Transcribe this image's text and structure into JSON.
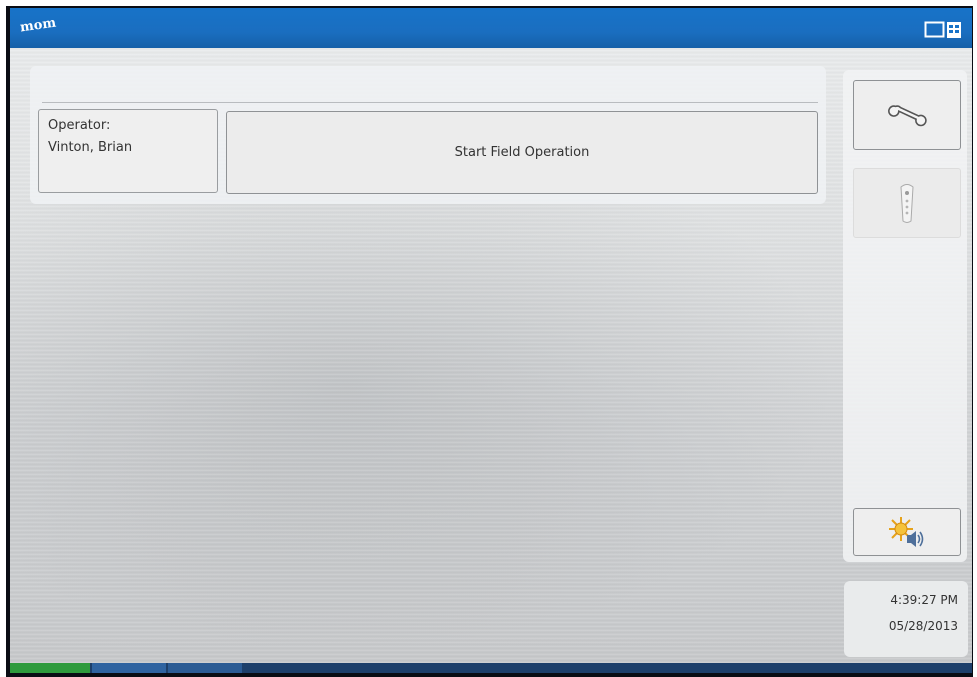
{
  "header": {
    "logo_text": "mom",
    "icons": {
      "display_switch": "display-switch-icon"
    },
    "colors": {
      "bar": "#1773c8"
    }
  },
  "main": {
    "operator_label": "Operator:",
    "operator_name": "Vinton, Brian",
    "start_button_label": "Start Field Operation"
  },
  "sidebar": {
    "items": [
      {
        "name": "wrench-icon",
        "enabled": true
      },
      {
        "name": "remote-icon",
        "enabled": false
      },
      {
        "name": "brightness-volume-icon",
        "enabled": true
      }
    ]
  },
  "status": {
    "time": "4:39:27 PM",
    "date": "05/28/2013"
  },
  "footer": {
    "colors": {
      "active_tab": "#2e9a3c",
      "tab": "#2f63a0"
    }
  }
}
